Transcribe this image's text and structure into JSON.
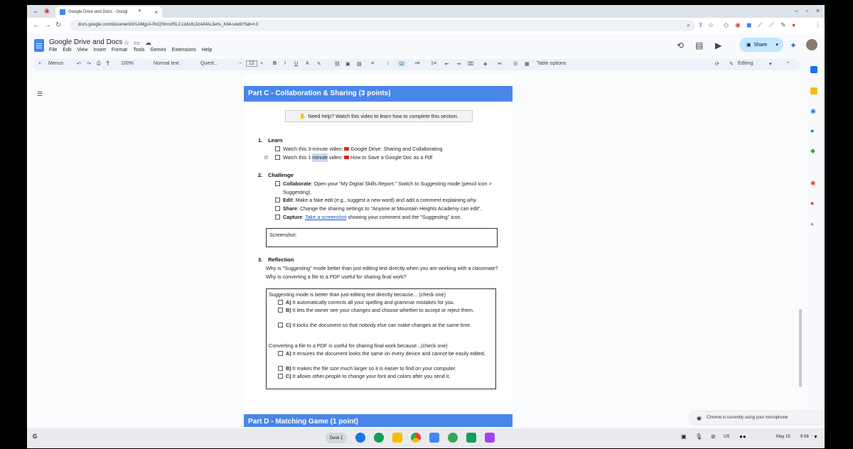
{
  "browser": {
    "tab_title": "Google Drive and Docs - Googl",
    "url": "docs.google.com/document/d/1AMgcA-RoQShrrofSL2-LkbUlcJiz4AfAL3ehs_K84-s/edit?tab=t.0"
  },
  "docs": {
    "title": "Google Drive and Docs",
    "menu": [
      "File",
      "Edit",
      "View",
      "Insert",
      "Format",
      "Tools",
      "Gemini",
      "Extensions",
      "Help"
    ],
    "share_label": "Share",
    "toolbar": {
      "menus": "Menus",
      "zoom": "100%",
      "style": "Normal text",
      "font": "Quest...",
      "font_size": "12",
      "table_options": "Table options",
      "mode": "Editing"
    }
  },
  "document": {
    "part_c_title": "Part C - Collaboration & Sharing (3 points)",
    "help_text": "Need help? Watch this video to learn how to complete this section.",
    "learn": {
      "num": "1.",
      "title": "Learn",
      "items": [
        {
          "prefix": "Watch this 3-minute video:",
          "link": "Google Drive: Sharing and Collaborating"
        },
        {
          "prefix_a": "Watch this 1 ",
          "prefix_sel": "minute",
          "prefix_b": " video:",
          "link": "How to Save a Google Doc as a Pdf"
        }
      ]
    },
    "challenge": {
      "num": "2.",
      "title": "Challenge",
      "items": [
        {
          "bold": "Collaborate",
          "text": ": Open your \"My Digital Skills Report.\" Switch to Suggesting mode (pencil icon > Suggesting)."
        },
        {
          "bold": "Edit",
          "text": ": Make a fake edit (e.g., suggest a new word) and add a comment explaining why."
        },
        {
          "bold": "Share",
          "text": ": Change the sharing settings to \"Anyone at Mountain Heights Academy can edit\"."
        },
        {
          "bold": "Capture",
          "text": ": ",
          "link": "Take a screenshot",
          "text2": " showing your comment and the \"Suggesting\" icon."
        }
      ]
    },
    "screenshot_label": "Screenshot:",
    "reflection": {
      "num": "3.",
      "title": "Reflection",
      "question": "Why is \"Suggesting\" mode better than just editing text directly when you are working with a classmate? Why is converting a file to a PDF useful for sharing final work?",
      "q1": "Suggesting mode is better than just editing text directly because... (check one)",
      "q1_options": [
        {
          "letter": "A)",
          "text": " It automatically corrects all your spelling and grammar mistakes for you."
        },
        {
          "letter": "B)",
          "text": " It lets the owner see your changes and choose whether to accept or reject them."
        },
        {
          "letter": "C)",
          "text": " It locks the document so that nobody else can make changes at the same time."
        }
      ],
      "q2": "Converting a file to a PDF is useful for sharing final work because...(check one)",
      "q2_options": [
        {
          "letter": "A)",
          "text": " It ensures the document looks the same on every device and cannot be easily edited."
        },
        {
          "letter": "B)",
          "text": " It makes the file size much larger so it is easier to find on your computer."
        },
        {
          "letter": "C)",
          "text": " It allows other people to change your font and colors after you send it."
        }
      ]
    },
    "part_d_title": "Part D - Matching Game (1 point)"
  },
  "system": {
    "desk": "Desk 1",
    "locale": "US",
    "date": "May 15",
    "time": "9:58",
    "toast": "Chrome is currently using your microphone"
  },
  "colors": {
    "band": "#4a86e8",
    "share": "#c2e7ff",
    "link": "#1155cc"
  }
}
